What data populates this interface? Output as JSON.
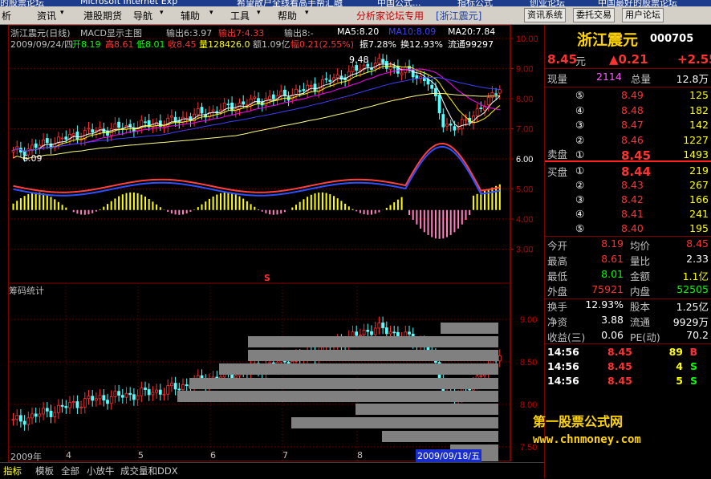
{
  "taskbar": {
    "items": [
      "的股票论坛",
      "Microsoft Internet Exp",
      "希望散户全线看高手帮汇融",
      "中国公式...",
      "指标公式",
      "创业论坛",
      "中国最好的股票论坛"
    ]
  },
  "menu": {
    "items": [
      "析",
      "资讯",
      "港股期货",
      "导航",
      "辅助",
      "工具",
      "帮助"
    ],
    "forum_text": "分析家论坛专用",
    "title": "[浙江震元]",
    "sys_buttons": [
      "资讯系统",
      "委托交易",
      "用户论坛"
    ]
  },
  "chart_header": {
    "stock": "浙江震元(日线)",
    "mode": "MACD显示主图",
    "out1": "输出6:3.97",
    "out2": "输出7:4.33",
    "out3": "输出8:-",
    "ma5": "MA5:8.20",
    "ma10": "MA10:8.09",
    "ma20": "MA20:7.84",
    "date": "2009/09/24/四",
    "open": "开8.19",
    "high": "高8.61",
    "low": "低8.01",
    "close": "收8.45",
    "vol": "量128426.0",
    "amount": "额1.09亿",
    "change": "幅0.21(2.55%)",
    "amp": "振7.28%",
    "turn": "换12.93%",
    "flow": "流通99297"
  },
  "chart_labels": {
    "high_mark": "9.48",
    "low_mark": "6.09",
    "s_marker": "S",
    "chip_title": "筹码统计",
    "months": [
      "2009年",
      "4",
      "5",
      "6",
      "7",
      "8"
    ],
    "current_date": "2009/09/18/五"
  },
  "axis": {
    "main_ticks": [
      "10.00",
      "9.00",
      "8.00",
      "7.00",
      "6.00",
      "5.00",
      "4.00",
      "3.00"
    ],
    "chip_ticks": [
      "9.00",
      "8.50",
      "8.00",
      "7.50"
    ]
  },
  "panel": {
    "name": "浙江震元",
    "code": "000705",
    "price": "8.45",
    "price_unit": "元",
    "change": "▲0.21",
    "change_pct": "+2.55",
    "current_vol_label": "现量",
    "current_vol": "2114",
    "total_vol_label": "总量",
    "total_vol": "12.8万",
    "sell_label": "卖盘",
    "buy_label": "买盘",
    "sells": [
      {
        "idx": "⑤",
        "price": "8.49",
        "vol": "125"
      },
      {
        "idx": "④",
        "price": "8.48",
        "vol": "182"
      },
      {
        "idx": "③",
        "price": "8.47",
        "vol": "142"
      },
      {
        "idx": "②",
        "price": "8.46",
        "vol": "1227"
      },
      {
        "idx": "①",
        "price": "8.45",
        "vol": "1493"
      }
    ],
    "buys": [
      {
        "idx": "①",
        "price": "8.44",
        "vol": "219"
      },
      {
        "idx": "②",
        "price": "8.43",
        "vol": "267"
      },
      {
        "idx": "③",
        "price": "8.42",
        "vol": "166"
      },
      {
        "idx": "④",
        "price": "8.41",
        "vol": "241"
      },
      {
        "idx": "⑤",
        "price": "8.40",
        "vol": "195"
      }
    ],
    "stats": [
      {
        "l1": "今开",
        "v1": "8.19",
        "l2": "均价",
        "v2": "8.45"
      },
      {
        "l1": "最高",
        "v1": "8.61",
        "l2": "量比",
        "v2": "2.33"
      },
      {
        "l1": "最低",
        "v1": "8.01",
        "l2": "金额",
        "v2": "1.1亿"
      },
      {
        "l1": "外盘",
        "v1": "75921",
        "l2": "内盘",
        "v2": "52505"
      },
      {
        "l1": "换手",
        "v1": "12.93%",
        "l2": "股本",
        "v2": "1.25亿"
      },
      {
        "l1": "净资",
        "v1": "3.88",
        "l2": "流通",
        "v2": "9929万"
      },
      {
        "l1": "收益(三)",
        "v1": "0.06",
        "l2": "PE(动)",
        "v2": "70.2"
      }
    ],
    "ticks": [
      {
        "time": "14:56",
        "price": "8.45",
        "vol": "89",
        "bs": "B"
      },
      {
        "time": "14:56",
        "price": "8.45",
        "vol": "4",
        "bs": "S"
      },
      {
        "time": "14:56",
        "price": "8.45",
        "vol": "5",
        "bs": "S"
      }
    ]
  },
  "watermark": {
    "line1": "第一股票公式网",
    "line2": "www.chnmoney.com"
  },
  "tabs": [
    "指标",
    "模板",
    "全部",
    "小放牛",
    "成交量和DDX"
  ],
  "colors": {
    "up": "#ff3232",
    "down": "#54ffff",
    "ma5": "#ffffff",
    "ma10": "#ffff00",
    "ma20": "#ff00ff",
    "macd_pos": "#ffff00",
    "macd_neg": "#ff7fbf",
    "chip": "#808080"
  }
}
